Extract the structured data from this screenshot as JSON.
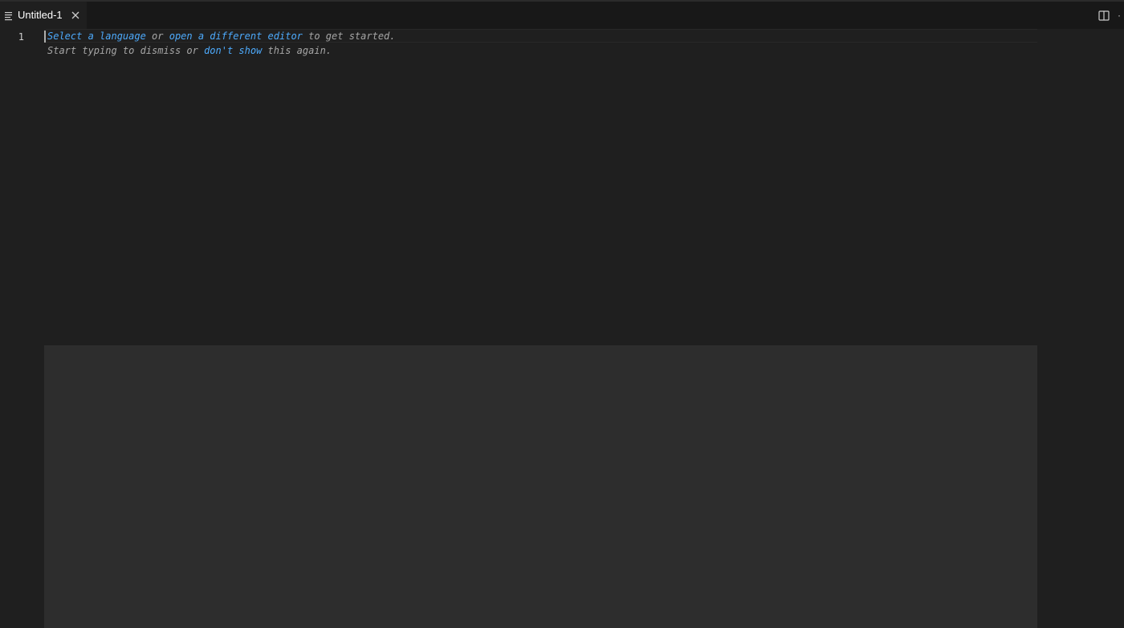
{
  "tab": {
    "label": "Untitled-1",
    "file_icon": "lines-icon",
    "close_icon": "close-icon"
  },
  "toolbar": {
    "split_icon": "split-editor-icon",
    "more_icon": "ellipsis-icon",
    "more_label": "·"
  },
  "editor": {
    "line_number": "1",
    "hint": {
      "select_language": "Select a language",
      "or_1": " or ",
      "open_editor": "open a different editor",
      "get_started": " to get started.",
      "start_typing": "Start typing to dismiss or ",
      "dont_show": "don't show",
      "this_again": " this again."
    }
  },
  "colors": {
    "background": "#1f1f1f",
    "tab_bar": "#181818",
    "link": "#4daafc",
    "hint_text": "#a6a6a6",
    "panel": "#2d2d2d"
  }
}
